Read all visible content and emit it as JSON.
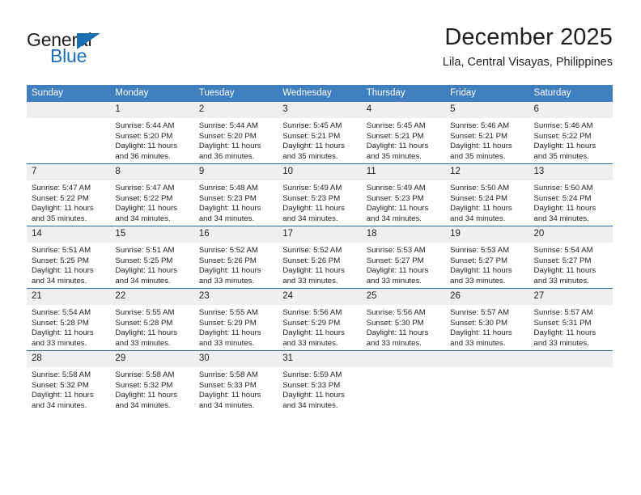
{
  "brand": {
    "word1": "General",
    "word2": "Blue",
    "triangle_color": "#1a6fb5",
    "text_color": "#231f20"
  },
  "header": {
    "title": "December 2025",
    "subtitle": "Lila, Central Visayas, Philippines"
  },
  "theme": {
    "header_blue": "#3f7fbf",
    "row_rule_blue": "#2b6cad",
    "daynum_band": "#efefef"
  },
  "weekday_headers": [
    "Sunday",
    "Monday",
    "Tuesday",
    "Wednesday",
    "Thursday",
    "Friday",
    "Saturday"
  ],
  "weeks": [
    [
      {
        "day": "",
        "sunrise": "",
        "sunset": "",
        "daylight1": "",
        "daylight2": ""
      },
      {
        "day": "1",
        "sunrise": "Sunrise: 5:44 AM",
        "sunset": "Sunset: 5:20 PM",
        "daylight1": "Daylight: 11 hours",
        "daylight2": "and 36 minutes."
      },
      {
        "day": "2",
        "sunrise": "Sunrise: 5:44 AM",
        "sunset": "Sunset: 5:20 PM",
        "daylight1": "Daylight: 11 hours",
        "daylight2": "and 36 minutes."
      },
      {
        "day": "3",
        "sunrise": "Sunrise: 5:45 AM",
        "sunset": "Sunset: 5:21 PM",
        "daylight1": "Daylight: 11 hours",
        "daylight2": "and 35 minutes."
      },
      {
        "day": "4",
        "sunrise": "Sunrise: 5:45 AM",
        "sunset": "Sunset: 5:21 PM",
        "daylight1": "Daylight: 11 hours",
        "daylight2": "and 35 minutes."
      },
      {
        "day": "5",
        "sunrise": "Sunrise: 5:46 AM",
        "sunset": "Sunset: 5:21 PM",
        "daylight1": "Daylight: 11 hours",
        "daylight2": "and 35 minutes."
      },
      {
        "day": "6",
        "sunrise": "Sunrise: 5:46 AM",
        "sunset": "Sunset: 5:22 PM",
        "daylight1": "Daylight: 11 hours",
        "daylight2": "and 35 minutes."
      }
    ],
    [
      {
        "day": "7",
        "sunrise": "Sunrise: 5:47 AM",
        "sunset": "Sunset: 5:22 PM",
        "daylight1": "Daylight: 11 hours",
        "daylight2": "and 35 minutes."
      },
      {
        "day": "8",
        "sunrise": "Sunrise: 5:47 AM",
        "sunset": "Sunset: 5:22 PM",
        "daylight1": "Daylight: 11 hours",
        "daylight2": "and 34 minutes."
      },
      {
        "day": "9",
        "sunrise": "Sunrise: 5:48 AM",
        "sunset": "Sunset: 5:23 PM",
        "daylight1": "Daylight: 11 hours",
        "daylight2": "and 34 minutes."
      },
      {
        "day": "10",
        "sunrise": "Sunrise: 5:49 AM",
        "sunset": "Sunset: 5:23 PM",
        "daylight1": "Daylight: 11 hours",
        "daylight2": "and 34 minutes."
      },
      {
        "day": "11",
        "sunrise": "Sunrise: 5:49 AM",
        "sunset": "Sunset: 5:23 PM",
        "daylight1": "Daylight: 11 hours",
        "daylight2": "and 34 minutes."
      },
      {
        "day": "12",
        "sunrise": "Sunrise: 5:50 AM",
        "sunset": "Sunset: 5:24 PM",
        "daylight1": "Daylight: 11 hours",
        "daylight2": "and 34 minutes."
      },
      {
        "day": "13",
        "sunrise": "Sunrise: 5:50 AM",
        "sunset": "Sunset: 5:24 PM",
        "daylight1": "Daylight: 11 hours",
        "daylight2": "and 34 minutes."
      }
    ],
    [
      {
        "day": "14",
        "sunrise": "Sunrise: 5:51 AM",
        "sunset": "Sunset: 5:25 PM",
        "daylight1": "Daylight: 11 hours",
        "daylight2": "and 34 minutes."
      },
      {
        "day": "15",
        "sunrise": "Sunrise: 5:51 AM",
        "sunset": "Sunset: 5:25 PM",
        "daylight1": "Daylight: 11 hours",
        "daylight2": "and 34 minutes."
      },
      {
        "day": "16",
        "sunrise": "Sunrise: 5:52 AM",
        "sunset": "Sunset: 5:26 PM",
        "daylight1": "Daylight: 11 hours",
        "daylight2": "and 33 minutes."
      },
      {
        "day": "17",
        "sunrise": "Sunrise: 5:52 AM",
        "sunset": "Sunset: 5:26 PM",
        "daylight1": "Daylight: 11 hours",
        "daylight2": "and 33 minutes."
      },
      {
        "day": "18",
        "sunrise": "Sunrise: 5:53 AM",
        "sunset": "Sunset: 5:27 PM",
        "daylight1": "Daylight: 11 hours",
        "daylight2": "and 33 minutes."
      },
      {
        "day": "19",
        "sunrise": "Sunrise: 5:53 AM",
        "sunset": "Sunset: 5:27 PM",
        "daylight1": "Daylight: 11 hours",
        "daylight2": "and 33 minutes."
      },
      {
        "day": "20",
        "sunrise": "Sunrise: 5:54 AM",
        "sunset": "Sunset: 5:27 PM",
        "daylight1": "Daylight: 11 hours",
        "daylight2": "and 33 minutes."
      }
    ],
    [
      {
        "day": "21",
        "sunrise": "Sunrise: 5:54 AM",
        "sunset": "Sunset: 5:28 PM",
        "daylight1": "Daylight: 11 hours",
        "daylight2": "and 33 minutes."
      },
      {
        "day": "22",
        "sunrise": "Sunrise: 5:55 AM",
        "sunset": "Sunset: 5:28 PM",
        "daylight1": "Daylight: 11 hours",
        "daylight2": "and 33 minutes."
      },
      {
        "day": "23",
        "sunrise": "Sunrise: 5:55 AM",
        "sunset": "Sunset: 5:29 PM",
        "daylight1": "Daylight: 11 hours",
        "daylight2": "and 33 minutes."
      },
      {
        "day": "24",
        "sunrise": "Sunrise: 5:56 AM",
        "sunset": "Sunset: 5:29 PM",
        "daylight1": "Daylight: 11 hours",
        "daylight2": "and 33 minutes."
      },
      {
        "day": "25",
        "sunrise": "Sunrise: 5:56 AM",
        "sunset": "Sunset: 5:30 PM",
        "daylight1": "Daylight: 11 hours",
        "daylight2": "and 33 minutes."
      },
      {
        "day": "26",
        "sunrise": "Sunrise: 5:57 AM",
        "sunset": "Sunset: 5:30 PM",
        "daylight1": "Daylight: 11 hours",
        "daylight2": "and 33 minutes."
      },
      {
        "day": "27",
        "sunrise": "Sunrise: 5:57 AM",
        "sunset": "Sunset: 5:31 PM",
        "daylight1": "Daylight: 11 hours",
        "daylight2": "and 33 minutes."
      }
    ],
    [
      {
        "day": "28",
        "sunrise": "Sunrise: 5:58 AM",
        "sunset": "Sunset: 5:32 PM",
        "daylight1": "Daylight: 11 hours",
        "daylight2": "and 34 minutes."
      },
      {
        "day": "29",
        "sunrise": "Sunrise: 5:58 AM",
        "sunset": "Sunset: 5:32 PM",
        "daylight1": "Daylight: 11 hours",
        "daylight2": "and 34 minutes."
      },
      {
        "day": "30",
        "sunrise": "Sunrise: 5:58 AM",
        "sunset": "Sunset: 5:33 PM",
        "daylight1": "Daylight: 11 hours",
        "daylight2": "and 34 minutes."
      },
      {
        "day": "31",
        "sunrise": "Sunrise: 5:59 AM",
        "sunset": "Sunset: 5:33 PM",
        "daylight1": "Daylight: 11 hours",
        "daylight2": "and 34 minutes."
      },
      {
        "day": "",
        "sunrise": "",
        "sunset": "",
        "daylight1": "",
        "daylight2": ""
      },
      {
        "day": "",
        "sunrise": "",
        "sunset": "",
        "daylight1": "",
        "daylight2": ""
      },
      {
        "day": "",
        "sunrise": "",
        "sunset": "",
        "daylight1": "",
        "daylight2": ""
      }
    ]
  ]
}
